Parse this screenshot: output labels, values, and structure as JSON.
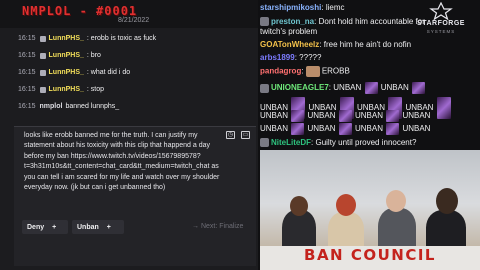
{
  "log": {
    "title": "NMPLOL - #0001",
    "date": "8/21/2022",
    "rows": [
      {
        "time": "16:15",
        "user": "LunnPHS_",
        "text": ": erobb is toxic as fuck"
      },
      {
        "time": "16:15",
        "user": "LunnPHS_",
        "text": ": bro"
      },
      {
        "time": "16:15",
        "user": "LunnPHS_",
        "text": ": what did i do"
      },
      {
        "time": "16:15",
        "user": "LunnPHS_",
        "text": ": stop"
      },
      {
        "time": "16:15",
        "user": "nmplol",
        "text": "banned lunnphs_"
      }
    ]
  },
  "appeal": {
    "text": "looks like erobb banned me for the truth. I can justify my statement about his toxicity with this clip that happend a day before my ban https://www.twitch.tv/videos/1567989578?t=3h31m10s&tt_content=chat_card&tt_medium=twitch_chat as you can tell i am scared for my life and watch over my shoulder everyday now. (jk but can i get unbanned tho)",
    "deny_label": "Deny",
    "unban_label": "Unban",
    "plus": "+",
    "next_label": "Next: Finalize"
  },
  "chat": {
    "lines": [
      {
        "user": "starshipmikoshi",
        "sep": ":",
        "text": "liemc",
        "color": "#8ab4ff"
      },
      {
        "user": "preston_na",
        "sep": ":",
        "text": "Dont hold him accountable for",
        "color": "#6fc6d0"
      },
      {
        "user": "",
        "sep": "",
        "text": "twitch's problem",
        "color": "#efeff1"
      },
      {
        "user": "GOATonWheelz",
        "sep": ":",
        "text": "free him he ain't do nofin",
        "color": "#f3c14a"
      },
      {
        "user": "arbs1899",
        "sep": ":",
        "text": "?????",
        "color": "#7c7cff"
      },
      {
        "user": "pandagrog",
        "sep": ":",
        "text": "EROBB",
        "color": "#ff7070"
      },
      {
        "user": "UNIONEAGLE7",
        "sep": ":",
        "text": "UNBAN",
        "color": "#6ee87a"
      },
      {
        "user": "",
        "sep": "",
        "text": "UNBAN",
        "color": "#efeff1"
      },
      {
        "user": "",
        "sep": "",
        "text": "UNBAN",
        "color": "#efeff1"
      },
      {
        "user": "",
        "sep": "",
        "text": "UNBAN",
        "color": "#efeff1"
      },
      {
        "user": "NiteLiteDF",
        "sep": ":",
        "text": "Guilty until proved innocent?",
        "color": "#2ec27e"
      }
    ],
    "unban_word": "UNBAN"
  },
  "brand": {
    "name": "STARFORGE",
    "sub": "SYSTEMS"
  },
  "stream": {
    "banner": "BAN COUNCIL"
  }
}
